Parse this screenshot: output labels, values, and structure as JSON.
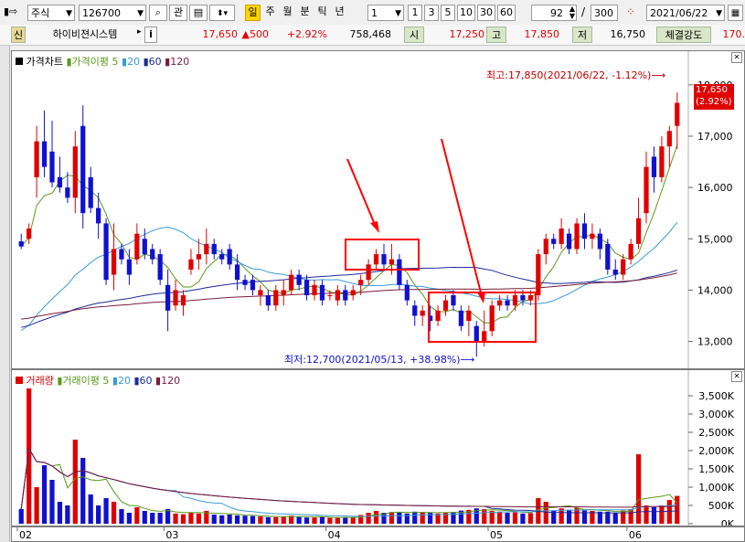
{
  "toolbar": {
    "market_type": "주식",
    "code": "126700",
    "search_icon": "search-icon",
    "related_label": "관",
    "periods": [
      "일",
      "주",
      "월",
      "분",
      "틱",
      "년"
    ],
    "active_period": "일",
    "interval_value": "1",
    "quick_intervals": [
      "1",
      "3",
      "5",
      "10",
      "30",
      "60"
    ],
    "count_value": "92",
    "separator": "/",
    "total_value": "300",
    "date_value": "2021/06/22"
  },
  "info": {
    "credit_label": "신",
    "name": "하이비젼시스템",
    "info_button": "i",
    "price": "17,650",
    "change": "▲500",
    "change_pct": "+2.92%",
    "volume": "758,468",
    "open_label": "시",
    "open": "17,250",
    "high_label": "고",
    "high": "17,850",
    "low_label": "저",
    "low": "16,750",
    "strength_label": "체결강도",
    "strength": "170."
  },
  "price_chart": {
    "legend": {
      "name": "가격차트",
      "ma_name": "가격이평",
      "ma_periods": [
        "5",
        "20",
        "60",
        "120"
      ]
    },
    "high_annotation": "최고:17,850(2021/06/22, -1.12%)⟶",
    "low_annotation": "최저:12,700(2021/05/13, +38.98%)⟶",
    "current_price_tag": "17,650",
    "current_pct_tag": "(2.92%)",
    "y_ticks": [
      "18,000",
      "17,000",
      "16,000",
      "15,000",
      "14,000",
      "13,000"
    ]
  },
  "volume_chart": {
    "legend": {
      "name": "거래량",
      "ma_name": "거래이평",
      "ma_periods": [
        "5",
        "20",
        "60",
        "120"
      ]
    },
    "y_ticks": [
      "3,500K",
      "3,000K",
      "2,500K",
      "2,000K",
      "1,500K",
      "1,000K",
      "500K",
      "0K"
    ]
  },
  "x_ticks": [
    "02",
    "03",
    "04",
    "05",
    "06"
  ],
  "colors": {
    "up": "#e00000",
    "down": "#1010d0",
    "ma5": "#5a9a1a",
    "ma20": "#3a9ad8",
    "ma60": "#1a2a9a",
    "ma120": "#7a1a3a",
    "highlight": "#ff0000"
  },
  "chart_data": {
    "type": "candlestick",
    "y_range": [
      12600,
      18300
    ],
    "volume_range": [
      0,
      3700
    ],
    "volume_unit": "K",
    "candles": [
      {
        "o": 14950,
        "h": 15100,
        "l": 14800,
        "c": 14850,
        "v": 400
      },
      {
        "o": 15000,
        "h": 15300,
        "l": 14900,
        "c": 15200,
        "v": 3700
      },
      {
        "o": 16200,
        "h": 17200,
        "l": 15800,
        "c": 16900,
        "v": 1000
      },
      {
        "o": 16900,
        "h": 17500,
        "l": 16200,
        "c": 16400,
        "v": 1600
      },
      {
        "o": 16700,
        "h": 17300,
        "l": 16000,
        "c": 16100,
        "v": 1200
      },
      {
        "o": 16200,
        "h": 16600,
        "l": 15900,
        "c": 16000,
        "v": 600
      },
      {
        "o": 16000,
        "h": 16300,
        "l": 15700,
        "c": 15800,
        "v": 500
      },
      {
        "o": 15800,
        "h": 17100,
        "l": 15500,
        "c": 16800,
        "v": 2300
      },
      {
        "o": 17200,
        "h": 17600,
        "l": 15200,
        "c": 15500,
        "v": 1800
      },
      {
        "o": 16200,
        "h": 16400,
        "l": 15500,
        "c": 15600,
        "v": 800
      },
      {
        "o": 15600,
        "h": 15900,
        "l": 15000,
        "c": 15300,
        "v": 500
      },
      {
        "o": 15300,
        "h": 15400,
        "l": 14100,
        "c": 14200,
        "v": 700
      },
      {
        "o": 14300,
        "h": 15300,
        "l": 14000,
        "c": 14800,
        "v": 600
      },
      {
        "o": 14800,
        "h": 14900,
        "l": 14500,
        "c": 14600,
        "v": 400
      },
      {
        "o": 14600,
        "h": 14800,
        "l": 14100,
        "c": 14300,
        "v": 300
      },
      {
        "o": 14600,
        "h": 15300,
        "l": 14500,
        "c": 15100,
        "v": 450
      },
      {
        "o": 15000,
        "h": 15200,
        "l": 14600,
        "c": 14700,
        "v": 350
      },
      {
        "o": 14800,
        "h": 14900,
        "l": 14500,
        "c": 14600,
        "v": 300
      },
      {
        "o": 14700,
        "h": 14800,
        "l": 14100,
        "c": 14200,
        "v": 300
      },
      {
        "o": 14100,
        "h": 14400,
        "l": 13200,
        "c": 13600,
        "v": 400
      },
      {
        "o": 13700,
        "h": 14200,
        "l": 13600,
        "c": 14000,
        "v": 280
      },
      {
        "o": 13700,
        "h": 14000,
        "l": 13500,
        "c": 13900,
        "v": 260
      },
      {
        "o": 14400,
        "h": 14800,
        "l": 14300,
        "c": 14600,
        "v": 300
      },
      {
        "o": 14600,
        "h": 15000,
        "l": 14400,
        "c": 14700,
        "v": 280
      },
      {
        "o": 14700,
        "h": 15200,
        "l": 14500,
        "c": 14900,
        "v": 350
      },
      {
        "o": 14900,
        "h": 15000,
        "l": 14600,
        "c": 14700,
        "v": 250
      },
      {
        "o": 14700,
        "h": 14800,
        "l": 14500,
        "c": 14600,
        "v": 230
      },
      {
        "o": 14800,
        "h": 14900,
        "l": 14400,
        "c": 14500,
        "v": 250
      },
      {
        "o": 14500,
        "h": 14700,
        "l": 14000,
        "c": 14200,
        "v": 230
      },
      {
        "o": 14200,
        "h": 14300,
        "l": 14000,
        "c": 14100,
        "v": 220
      },
      {
        "o": 14200,
        "h": 14300,
        "l": 13900,
        "c": 14000,
        "v": 210
      },
      {
        "o": 13900,
        "h": 14100,
        "l": 13700,
        "c": 14000,
        "v": 200
      },
      {
        "o": 13900,
        "h": 14000,
        "l": 13600,
        "c": 13700,
        "v": 180
      },
      {
        "o": 13700,
        "h": 14100,
        "l": 13600,
        "c": 14000,
        "v": 180
      },
      {
        "o": 13900,
        "h": 14200,
        "l": 13700,
        "c": 14000,
        "v": 200
      },
      {
        "o": 14000,
        "h": 14400,
        "l": 13900,
        "c": 14300,
        "v": 220
      },
      {
        "o": 14300,
        "h": 14400,
        "l": 14000,
        "c": 14100,
        "v": 200
      },
      {
        "o": 14200,
        "h": 14300,
        "l": 13800,
        "c": 13900,
        "v": 170
      },
      {
        "o": 13900,
        "h": 14200,
        "l": 13800,
        "c": 14100,
        "v": 170
      },
      {
        "o": 14100,
        "h": 14200,
        "l": 13700,
        "c": 13800,
        "v": 190
      },
      {
        "o": 13900,
        "h": 14000,
        "l": 13800,
        "c": 13900,
        "v": 160
      },
      {
        "o": 13800,
        "h": 14100,
        "l": 13700,
        "c": 14000,
        "v": 160
      },
      {
        "o": 14000,
        "h": 14100,
        "l": 13700,
        "c": 13800,
        "v": 180
      },
      {
        "o": 13900,
        "h": 14100,
        "l": 13800,
        "c": 14000,
        "v": 170
      },
      {
        "o": 14100,
        "h": 14300,
        "l": 13900,
        "c": 14200,
        "v": 240
      },
      {
        "o": 14200,
        "h": 14600,
        "l": 14100,
        "c": 14500,
        "v": 300
      },
      {
        "o": 14500,
        "h": 14800,
        "l": 14400,
        "c": 14700,
        "v": 350
      },
      {
        "o": 14700,
        "h": 14900,
        "l": 14400,
        "c": 14500,
        "v": 300
      },
      {
        "o": 14500,
        "h": 14900,
        "l": 14300,
        "c": 14600,
        "v": 320
      },
      {
        "o": 14600,
        "h": 14700,
        "l": 14000,
        "c": 14100,
        "v": 300
      },
      {
        "o": 14100,
        "h": 14200,
        "l": 13700,
        "c": 13800,
        "v": 280
      },
      {
        "o": 13700,
        "h": 13800,
        "l": 13300,
        "c": 13500,
        "v": 330
      },
      {
        "o": 13500,
        "h": 13700,
        "l": 13300,
        "c": 13600,
        "v": 320
      },
      {
        "o": 13500,
        "h": 13700,
        "l": 13200,
        "c": 13400,
        "v": 300
      },
      {
        "o": 13400,
        "h": 13700,
        "l": 13300,
        "c": 13600,
        "v": 280
      },
      {
        "o": 13600,
        "h": 13900,
        "l": 13500,
        "c": 13800,
        "v": 300
      },
      {
        "o": 13900,
        "h": 14000,
        "l": 13600,
        "c": 13700,
        "v": 320
      },
      {
        "o": 13600,
        "h": 13700,
        "l": 13200,
        "c": 13300,
        "v": 360
      },
      {
        "o": 13400,
        "h": 13700,
        "l": 13100,
        "c": 13600,
        "v": 380
      },
      {
        "o": 13300,
        "h": 13400,
        "l": 12700,
        "c": 13000,
        "v": 420
      },
      {
        "o": 13000,
        "h": 13600,
        "l": 12900,
        "c": 13200,
        "v": 400
      },
      {
        "o": 13200,
        "h": 13800,
        "l": 13100,
        "c": 13700,
        "v": 350
      },
      {
        "o": 13700,
        "h": 13900,
        "l": 13600,
        "c": 13800,
        "v": 330
      },
      {
        "o": 13800,
        "h": 13900,
        "l": 13600,
        "c": 13700,
        "v": 300
      },
      {
        "o": 13700,
        "h": 14000,
        "l": 13600,
        "c": 13900,
        "v": 310
      },
      {
        "o": 13900,
        "h": 14000,
        "l": 13700,
        "c": 13800,
        "v": 280
      },
      {
        "o": 13800,
        "h": 14000,
        "l": 13700,
        "c": 13900,
        "v": 290
      },
      {
        "o": 13900,
        "h": 14800,
        "l": 13800,
        "c": 14700,
        "v": 700
      },
      {
        "o": 14700,
        "h": 15100,
        "l": 14500,
        "c": 15000,
        "v": 600
      },
      {
        "o": 15000,
        "h": 15100,
        "l": 14800,
        "c": 14900,
        "v": 350
      },
      {
        "o": 14900,
        "h": 15400,
        "l": 14800,
        "c": 15200,
        "v": 420
      },
      {
        "o": 15100,
        "h": 15200,
        "l": 14700,
        "c": 14800,
        "v": 380
      },
      {
        "o": 14800,
        "h": 15400,
        "l": 14700,
        "c": 15300,
        "v": 430
      },
      {
        "o": 15300,
        "h": 15500,
        "l": 14800,
        "c": 15000,
        "v": 360
      },
      {
        "o": 15000,
        "h": 15300,
        "l": 14800,
        "c": 15100,
        "v": 350
      },
      {
        "o": 15100,
        "h": 15200,
        "l": 14600,
        "c": 14800,
        "v": 330
      },
      {
        "o": 14900,
        "h": 15000,
        "l": 14300,
        "c": 14400,
        "v": 330
      },
      {
        "o": 14400,
        "h": 14600,
        "l": 14200,
        "c": 14300,
        "v": 300
      },
      {
        "o": 14300,
        "h": 14700,
        "l": 14200,
        "c": 14600,
        "v": 360
      },
      {
        "o": 14600,
        "h": 15000,
        "l": 14500,
        "c": 14900,
        "v": 400
      },
      {
        "o": 14900,
        "h": 15800,
        "l": 14800,
        "c": 15400,
        "v": 1900
      },
      {
        "o": 15500,
        "h": 16700,
        "l": 15300,
        "c": 16400,
        "v": 500
      },
      {
        "o": 16600,
        "h": 16800,
        "l": 15900,
        "c": 16200,
        "v": 450
      },
      {
        "o": 16200,
        "h": 17000,
        "l": 16100,
        "c": 16800,
        "v": 500
      },
      {
        "o": 16800,
        "h": 17200,
        "l": 16400,
        "c": 17100,
        "v": 650
      },
      {
        "o": 17200,
        "h": 17850,
        "l": 16750,
        "c": 17650,
        "v": 760
      }
    ]
  }
}
